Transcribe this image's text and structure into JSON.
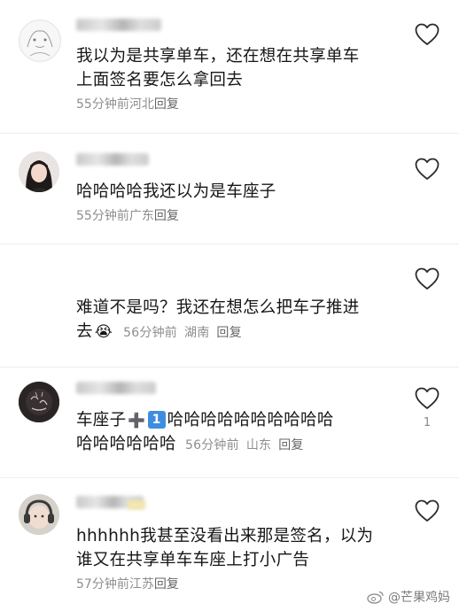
{
  "comments": [
    {
      "text_lines": [
        "我以为是共享单车，还在想在共享单车",
        "上面签名要怎么拿回去"
      ],
      "time": "55分钟前",
      "location": "河北",
      "reply": "回复"
    },
    {
      "text_lines": [
        "哈哈哈哈我还以为是车座子"
      ],
      "time": "55分钟前",
      "location": "广东",
      "reply": "回复"
    },
    {
      "text_lines": [
        "难道不是吗？我还在想怎么把车子推进",
        "去"
      ],
      "emoji": "😭",
      "time": "56分钟前",
      "location": "湖南",
      "reply": "回复"
    },
    {
      "text_lines": [
        "车座子",
        "哈哈哈哈哈哈哈哈哈哈",
        "哈哈哈哈哈哈"
      ],
      "plus_emoji": "➕",
      "keycap": "1",
      "like_count": "1",
      "time": "56分钟前",
      "location": "山东",
      "reply": "回复"
    },
    {
      "text_lines": [
        "hhhhhh我甚至没看出来那是签名，以为",
        "谁又在共享单车车座上打小广告"
      ],
      "time": "57分钟前",
      "location": "江苏",
      "reply": "回复"
    }
  ],
  "watermark": "@芒果鸡妈",
  "icons": {
    "like": "heart-outline-icon",
    "weibo": "weibo-logo-icon"
  },
  "colors": {
    "text": "#161616",
    "meta": "#8e8e8e",
    "heart_stroke": "#2b2b2b",
    "keycap": "#3f8ede"
  }
}
